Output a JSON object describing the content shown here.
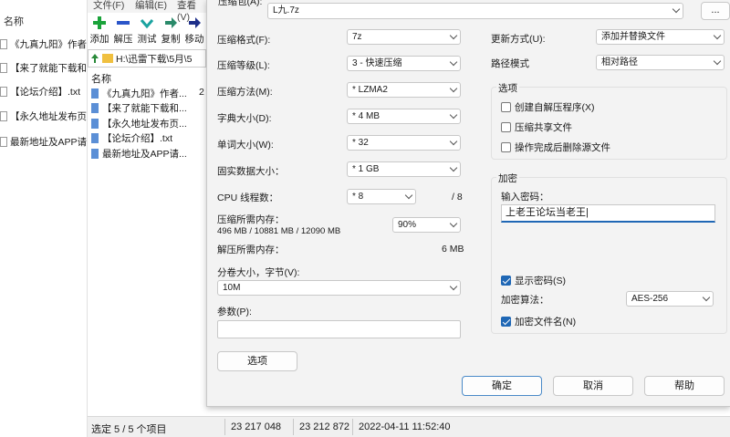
{
  "explorer": {
    "header": "名称",
    "items": [
      "《九真九阳》作者",
      "【来了就能下载和",
      "【论坛介绍】.txt",
      "【永久地址发布页",
      "最新地址及APP请"
    ]
  },
  "zip": {
    "menu": [
      "文件(F)",
      "编辑(E)",
      "查看(V)"
    ],
    "toolbar": [
      "添加",
      "解压",
      "测试",
      "复制",
      "移动"
    ],
    "address": "H:\\迅雷下载\\5月\\5",
    "column_name": "名称",
    "column_extra": "2",
    "items": [
      "《九真九阳》作者...",
      "【来了就能下载和...",
      "【永久地址发布页...",
      "【论坛介绍】.txt",
      "最新地址及APP请..."
    ]
  },
  "status": {
    "selection": "选定 5 / 5 个项目",
    "size": "23 217 048",
    "packed": "23 212 872",
    "modified": "2022-04-11 11:52:40"
  },
  "dialog": {
    "archive_label": "压缩包(A):",
    "archive_value": "L九.7z",
    "browse_label": "...",
    "format_label": "压缩格式(F):",
    "format_value": "7z",
    "level_label": "压缩等级(L):",
    "level_value": "3 - 快速压缩",
    "method_label": "压缩方法(M):",
    "method_value": "* LZMA2",
    "dict_label": "字典大小(D):",
    "dict_value": "* 4 MB",
    "word_label": "单词大小(W):",
    "word_value": "* 32",
    "solid_label": "固实数据大小：",
    "solid_value": "* 1 GB",
    "threads_label": "CPU 线程数：",
    "threads_value": "* 8",
    "threads_total": "/ 8",
    "mem_comp_label": "压缩所需内存：",
    "mem_comp_value": "496 MB / 10881 MB / 12090 MB",
    "mem_percent": "90%",
    "mem_decomp_label": "解压所需内存：",
    "mem_decomp_value": "6 MB",
    "split_label": "分卷大小，字节(V):",
    "split_value": "10M",
    "params_label": "参数(P):",
    "params_value": "",
    "options_button": "选项",
    "update_label": "更新方式(U):",
    "update_value": "添加并替换文件",
    "path_label": "路径模式",
    "path_value": "相对路径",
    "options_group": "选项",
    "opt_sfx": "创建自解压程序(X)",
    "opt_shared": "压缩共享文件",
    "opt_delete": "操作完成后删除源文件",
    "encrypt_group": "加密",
    "password_label": "输入密码：",
    "password_value": "上老王论坛当老王|",
    "show_password": "显示密码(S)",
    "enc_method_label": "加密算法：",
    "enc_method_value": "AES-256",
    "encrypt_names": "加密文件名(N)",
    "ok": "确定",
    "cancel": "取消",
    "help": "帮助"
  }
}
